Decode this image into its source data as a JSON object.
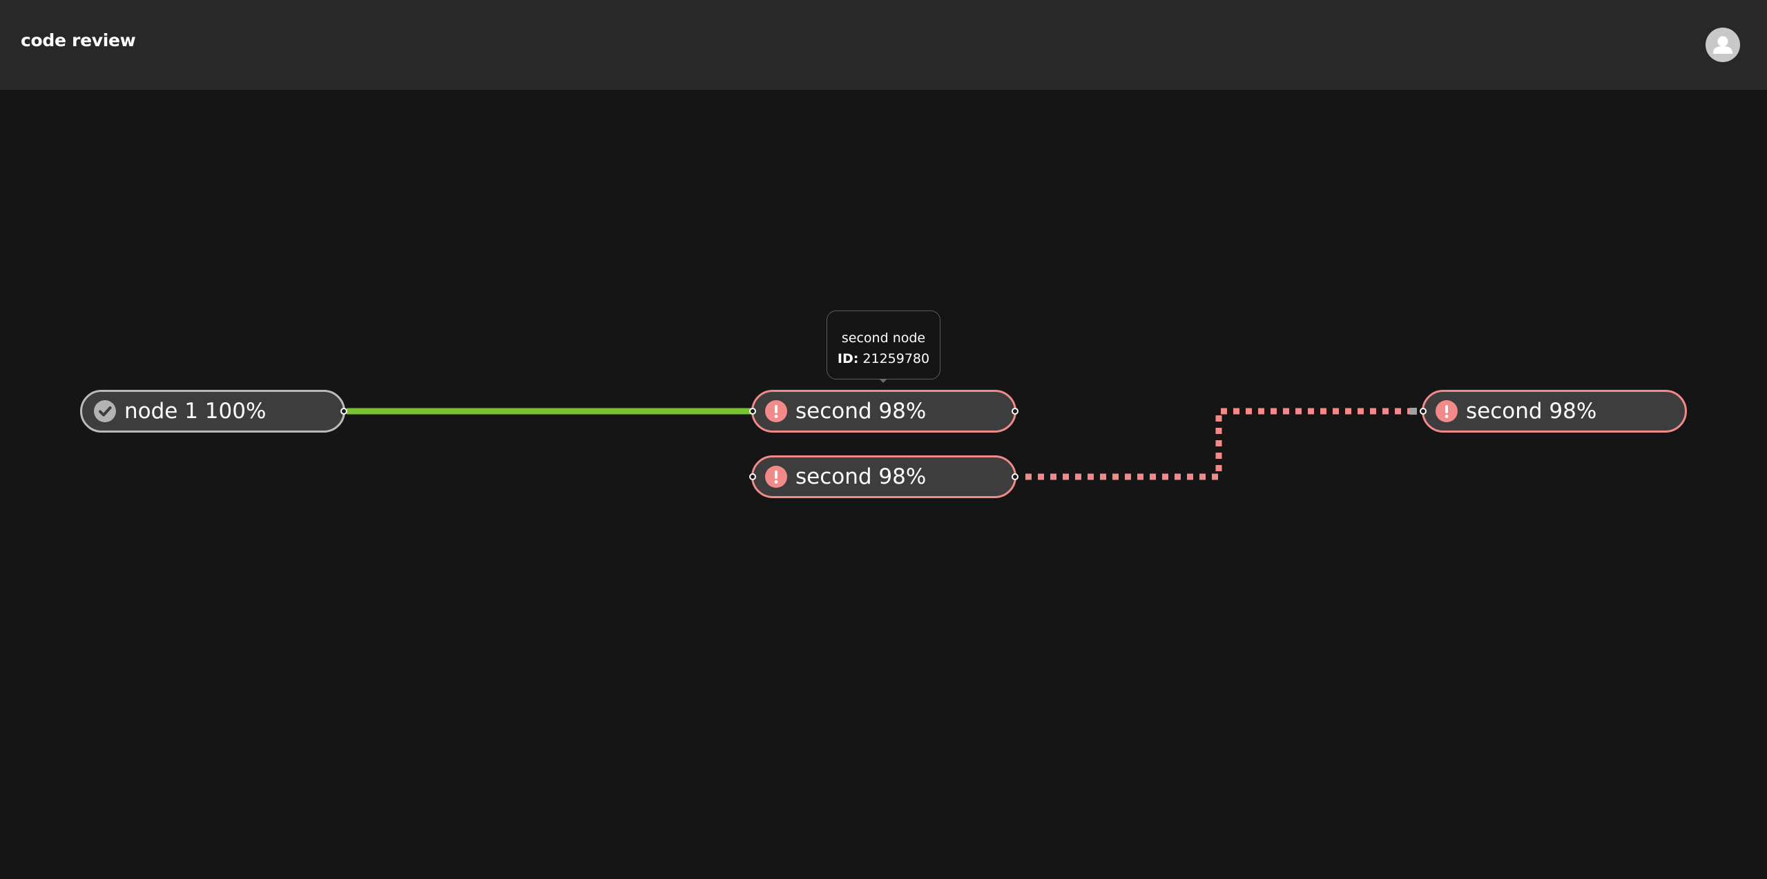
{
  "header": {
    "title": "code review",
    "avatar_icon": "user-avatar-icon"
  },
  "tooltip": {
    "title": "second node",
    "id_label": "ID:",
    "id_value": "21259780"
  },
  "nodes": [
    {
      "label": "node 1 100%",
      "status": "success",
      "icon": "check-circle-icon"
    },
    {
      "label": "second 98%",
      "status": "error",
      "icon": "exclamation-circle-icon"
    },
    {
      "label": "second 98%",
      "status": "error",
      "icon": "exclamation-circle-icon"
    },
    {
      "label": "second 98%",
      "status": "error",
      "icon": "exclamation-circle-icon"
    }
  ],
  "edges": [
    {
      "from": "node 1 100%",
      "to": "second 98%",
      "style": "solid",
      "color": "#7ac231"
    },
    {
      "from": "second 98%",
      "to": "second 98%",
      "style": "dotted",
      "color": "#f28a8a"
    }
  ],
  "colors": {
    "success_edge": "#7ac231",
    "error": "#f28a8a",
    "node_fill": "#3d3d3d",
    "background": "#151515",
    "header": "#282828"
  }
}
